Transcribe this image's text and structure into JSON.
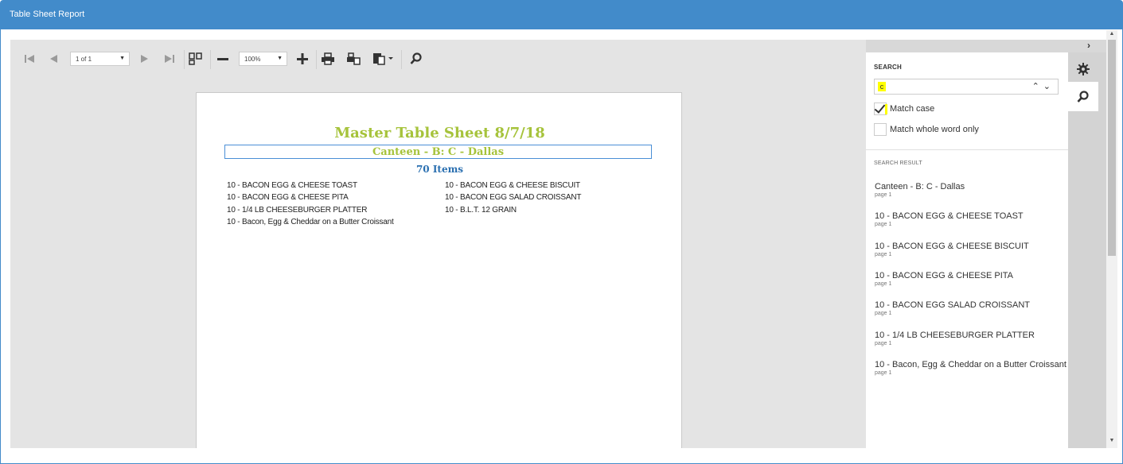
{
  "window": {
    "title": "Table Sheet Report"
  },
  "toolbar": {
    "first_icon": "⏮",
    "prev_icon": "◀",
    "page_select": "1 of 1",
    "next_icon": "▶",
    "last_icon": "⏭",
    "zoom_select": "100%",
    "dropdown_caret": "▼"
  },
  "report": {
    "title": "Master Table Sheet  8/7/18",
    "subtitle": "Canteen - B: C - Dallas",
    "count": "70 Items",
    "left_items": [
      "10 - BACON EGG & CHEESE TOAST",
      "10 - BACON EGG & CHEESE PITA",
      "10 - 1/4 LB CHEESEBURGER PLATTER",
      "10 - Bacon, Egg & Cheddar on a Butter Croissant"
    ],
    "right_items": [
      "10 - BACON EGG & CHEESE BISCUIT",
      "10 - BACON  EGG SALAD CROISSANT",
      "10 - B.L.T. 12 GRAIN"
    ]
  },
  "search_panel": {
    "heading": "SEARCH",
    "query": "c",
    "match_case_label": "Match case",
    "match_case_checked": true,
    "match_whole_label": "Match whole word only",
    "match_whole_checked": false,
    "results_heading": "SEARCH RESULT",
    "results": [
      {
        "text": "Canteen - B: C - Dallas",
        "page": "page 1"
      },
      {
        "text": "10 - BACON EGG & CHEESE TOAST",
        "page": "page 1"
      },
      {
        "text": "10 - BACON EGG & CHEESE BISCUIT",
        "page": "page 1"
      },
      {
        "text": "10 - BACON EGG & CHEESE PITA",
        "page": "page 1"
      },
      {
        "text": "10 - BACON EGG SALAD CROISSANT",
        "page": "page 1"
      },
      {
        "text": "10 - 1/4 LB CHEESEBURGER PLATTER",
        "page": "page 1"
      },
      {
        "text": "10 - Bacon, Egg & Cheddar on a Butter Croissant",
        "page": "page 1"
      }
    ]
  },
  "side_tabs": {
    "collapse_icon": "›"
  },
  "colors": {
    "header": "#428bca",
    "report_title": "#a6c33b",
    "report_count": "#2a6fb0",
    "highlight": "#ffff00"
  }
}
